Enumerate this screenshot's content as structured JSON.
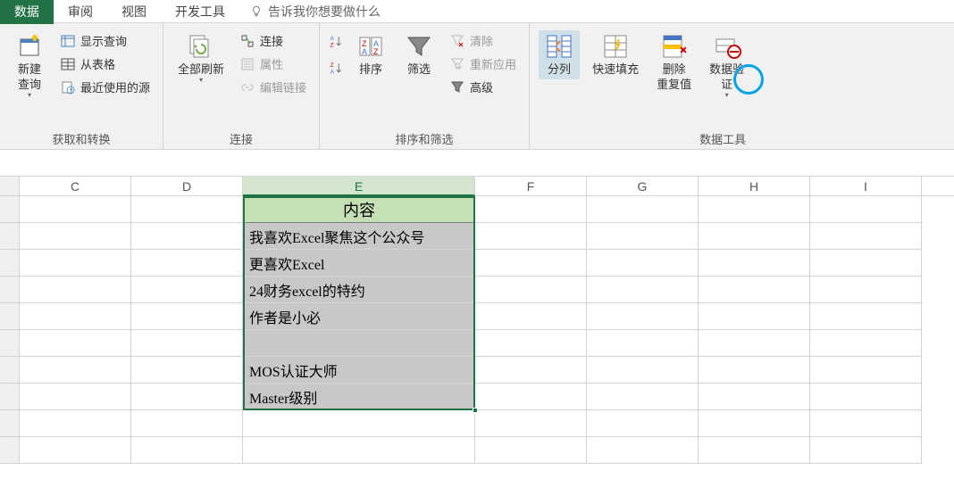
{
  "tabs": {
    "data": "数据",
    "review": "审阅",
    "view": "视图",
    "developer": "开发工具",
    "tell_me": "告诉我你想要做什么"
  },
  "ribbon": {
    "get_transform": {
      "new_query": "新建\n查询",
      "show_query": "显示查询",
      "from_table": "从表格",
      "recent_sources": "最近使用的源",
      "label": "获取和转换"
    },
    "connections": {
      "refresh_all": "全部刷新",
      "connections": "连接",
      "properties": "属性",
      "edit_links": "编辑链接",
      "label": "连接"
    },
    "sort_filter": {
      "sort": "排序",
      "filter": "筛选",
      "clear": "清除",
      "reapply": "重新应用",
      "advanced": "高级",
      "label": "排序和筛选"
    },
    "data_tools": {
      "text_to_columns": "分列",
      "flash_fill": "快速填充",
      "remove_dup": "删除\n重复值",
      "data_validation": "数据验\n证",
      "label": "数据工具"
    }
  },
  "columns": [
    "C",
    "D",
    "E",
    "F",
    "G",
    "H",
    "I"
  ],
  "sheet": {
    "header": "内容",
    "rows": [
      "我喜欢Excel聚焦这个公众号",
      "更喜欢Excel",
      "24财务excel的特约",
      "作者是小必",
      "",
      "MOS认证大师",
      "Master级别"
    ]
  }
}
